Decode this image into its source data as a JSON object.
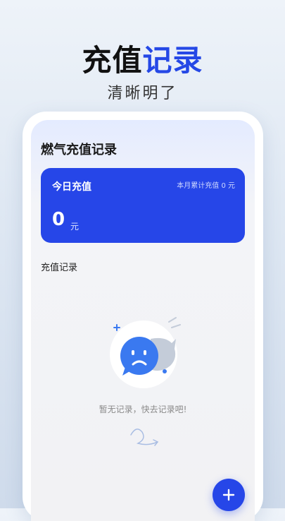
{
  "promo": {
    "title_main": "充值",
    "title_accent": "记录",
    "subtitle": "清晰明了"
  },
  "app": {
    "page_title": "燃气充值记录",
    "summary_card": {
      "today_label": "今日充值",
      "month_total_text": "本月累计充值 0 元",
      "amount": "0",
      "unit": "元"
    },
    "records_section_label": "充值记录",
    "empty_state_text": "暂无记录，快去记录吧!",
    "add_button_icon": "plus-icon"
  },
  "colors": {
    "accent": "#2548e6",
    "card_bg": "#2646e8"
  }
}
